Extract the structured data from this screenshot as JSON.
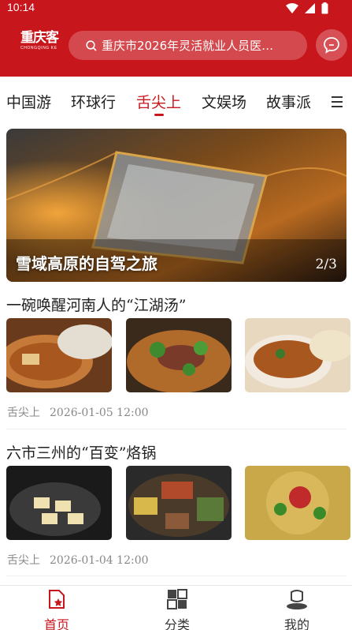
{
  "status_bar": {
    "time": "10:14"
  },
  "header": {
    "logo_text": "重庆客",
    "logo_subtext": "CHONGQING KE",
    "search_placeholder": "重庆市2026年灵活就业人员医…"
  },
  "tabs": [
    {
      "label": "中国游"
    },
    {
      "label": "环球行"
    },
    {
      "label": "舌尖上"
    },
    {
      "label": "文娱场"
    },
    {
      "label": "故事派"
    }
  ],
  "banner": {
    "title": "雪域高原的自驾之旅",
    "page_indicator": "2/3"
  },
  "articles": [
    {
      "title": "一碗唤醒河南人的“江湖汤”",
      "category": "舌尖上",
      "date": "2026-01-05 12:00"
    },
    {
      "title": "六市三州的“百变”烙锅",
      "category": "舌尖上",
      "date": "2026-01-04 12:00"
    }
  ],
  "bottom_nav": [
    {
      "label": "首页",
      "icon": "home-doc-icon"
    },
    {
      "label": "分类",
      "icon": "category-grid-icon"
    },
    {
      "label": "我的",
      "icon": "profile-icon"
    }
  ],
  "colors": {
    "brand_red": "#c8161d"
  }
}
